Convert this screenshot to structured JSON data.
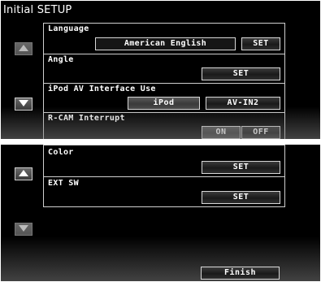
{
  "header": {
    "title": "Initial SETUP"
  },
  "page1": {
    "scroll_up_icon": "triangle-up",
    "scroll_down_icon": "triangle-down",
    "language": {
      "label": "Language",
      "value": "American English",
      "button": "SET"
    },
    "angle": {
      "label": "Angle",
      "button": "SET"
    },
    "ipod_av": {
      "label": "iPod AV Interface Use",
      "option_1": "iPod",
      "option_2": "AV-IN2"
    },
    "rcam": {
      "label": "R-CAM Interrupt",
      "on": "ON",
      "off": "OFF",
      "selected": "ON"
    }
  },
  "page2": {
    "scroll_up_icon": "triangle-up",
    "scroll_down_icon": "triangle-down",
    "color": {
      "label": "Color",
      "button": "SET"
    },
    "ext_sw": {
      "label": "EXT SW",
      "button": "SET"
    },
    "finish_button": "Finish"
  }
}
